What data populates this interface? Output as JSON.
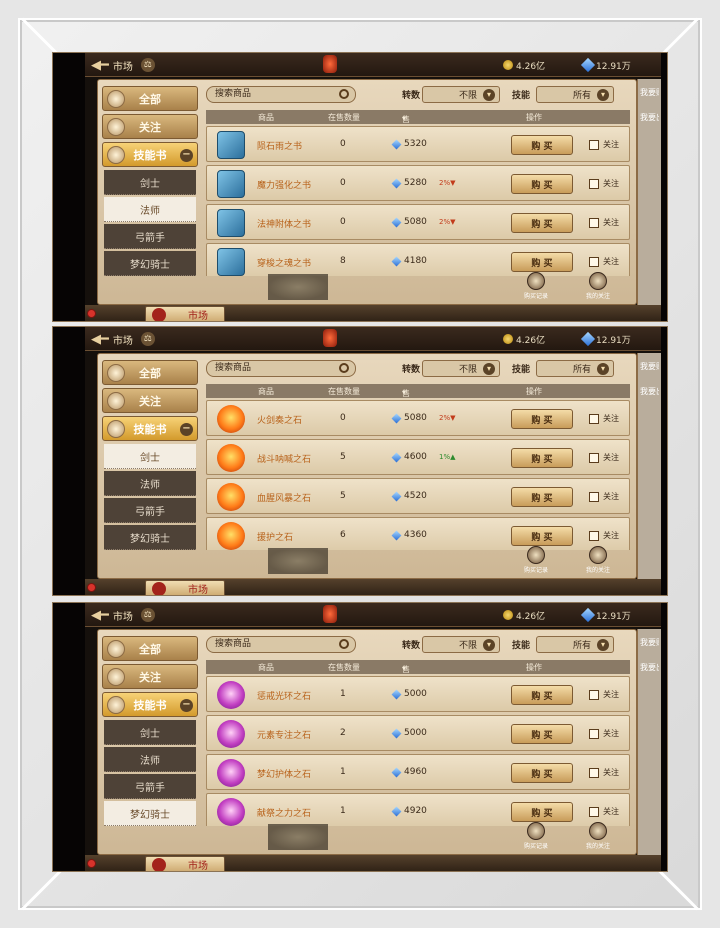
{
  "header": {
    "back_label": "市场",
    "gold": "4.26亿",
    "gems": "12.91万"
  },
  "filters": {
    "search_placeholder": "搜索商品",
    "rebirth_label": "转数",
    "rebirth_value": "不限",
    "skill_label": "技能",
    "skill_value": "所有"
  },
  "table_headers": {
    "item": "商品",
    "on_sale": "在售数量",
    "price": "售价",
    "action": "操作"
  },
  "categories": {
    "all": "全部",
    "follow": "关注",
    "skill_book": "技能书",
    "subs": [
      "剑士",
      "法师",
      "弓箭手",
      "梦幻骑士"
    ]
  },
  "side_panel": {
    "want_buy": "我要购买",
    "want_sell": "我要出售"
  },
  "bottom": {
    "market_tab": "市场",
    "purchase_record": "购买记录",
    "my_follow": "我的关注"
  },
  "row_buttons": {
    "buy": "购 买",
    "follow": "关注"
  },
  "screens": [
    {
      "selected_sub": 1,
      "rows": [
        {
          "name": "陨石雨之书",
          "qty": "0",
          "price": "5320",
          "trend": "",
          "icon": "book"
        },
        {
          "name": "魔力强化之书",
          "qty": "0",
          "price": "5280",
          "trend": "2%",
          "trend_dir": "down",
          "icon": "book"
        },
        {
          "name": "法神附体之书",
          "qty": "0",
          "price": "5080",
          "trend": "2%",
          "trend_dir": "down",
          "icon": "book"
        },
        {
          "name": "穿梭之魂之书",
          "qty": "8",
          "price": "4180",
          "trend": "",
          "icon": "book"
        }
      ]
    },
    {
      "selected_sub": 0,
      "rows": [
        {
          "name": "火剑奏之石",
          "qty": "0",
          "price": "5080",
          "trend": "2%",
          "trend_dir": "down",
          "icon": "fire"
        },
        {
          "name": "战斗呐喊之石",
          "qty": "5",
          "price": "4600",
          "trend": "1%",
          "trend_dir": "up",
          "icon": "fire"
        },
        {
          "name": "血腥风暴之石",
          "qty": "5",
          "price": "4520",
          "trend": "",
          "icon": "fire"
        },
        {
          "name": "援护之石",
          "qty": "6",
          "price": "4360",
          "trend": "",
          "icon": "fire"
        }
      ]
    },
    {
      "selected_sub": 3,
      "rows": [
        {
          "name": "惩戒光环之石",
          "qty": "1",
          "price": "5000",
          "trend": "",
          "icon": "purple"
        },
        {
          "name": "元素专注之石",
          "qty": "2",
          "price": "5000",
          "trend": "",
          "icon": "purple"
        },
        {
          "name": "梦幻护体之石",
          "qty": "1",
          "price": "4960",
          "trend": "",
          "icon": "purple"
        },
        {
          "name": "献祭之力之石",
          "qty": "1",
          "price": "4920",
          "trend": "",
          "icon": "purple"
        }
      ]
    }
  ]
}
